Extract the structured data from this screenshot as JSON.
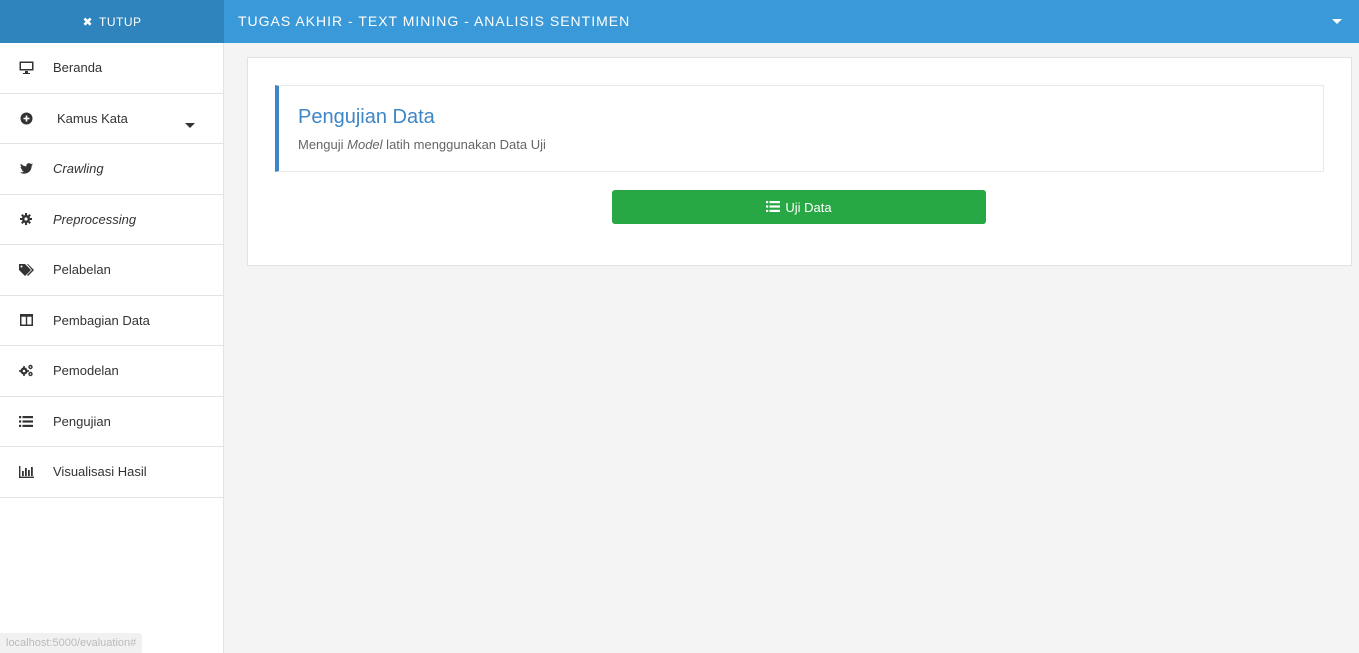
{
  "topbar": {
    "toggle_label": "TUTUP",
    "toggle_icon": "close-icon",
    "title": "TUGAS AKHIR - TEXT MINING - ANALISIS SENTIMEN",
    "caret_icon": "caret-down-icon",
    "bg_color": "#3a99d9",
    "toggle_bg_color": "#2f84bd"
  },
  "sidebar": {
    "items": [
      {
        "label": "Beranda",
        "icon": "desktop-icon"
      },
      {
        "label": "Kamus Kata",
        "icon": "plus-circle-icon",
        "has_dropdown": true
      },
      {
        "label": "Crawling",
        "icon": "twitter-icon",
        "italic": true
      },
      {
        "label": "Preprocessing",
        "icon": "gear-icon",
        "italic": true
      },
      {
        "label": "Pelabelan",
        "icon": "tags-icon"
      },
      {
        "label": "Pembagian Data",
        "icon": "columns-icon"
      },
      {
        "label": "Pemodelan",
        "icon": "gears-icon"
      },
      {
        "label": "Pengujian",
        "icon": "list-icon"
      },
      {
        "label": "Visualisasi Hasil",
        "icon": "bar-chart-icon"
      }
    ]
  },
  "status_bar": {
    "url": "localhost:5000/evaluation#"
  },
  "main": {
    "callout": {
      "title": "Pengujian Data",
      "subtitle_prefix": "Menguji ",
      "subtitle_em": "Model",
      "subtitle_suffix": " latih menggunakan Data Uji",
      "accent_color": "#3f86c6"
    },
    "action_button": {
      "label": "Uji Data",
      "icon": "list-icon",
      "color": "#28a745"
    }
  }
}
